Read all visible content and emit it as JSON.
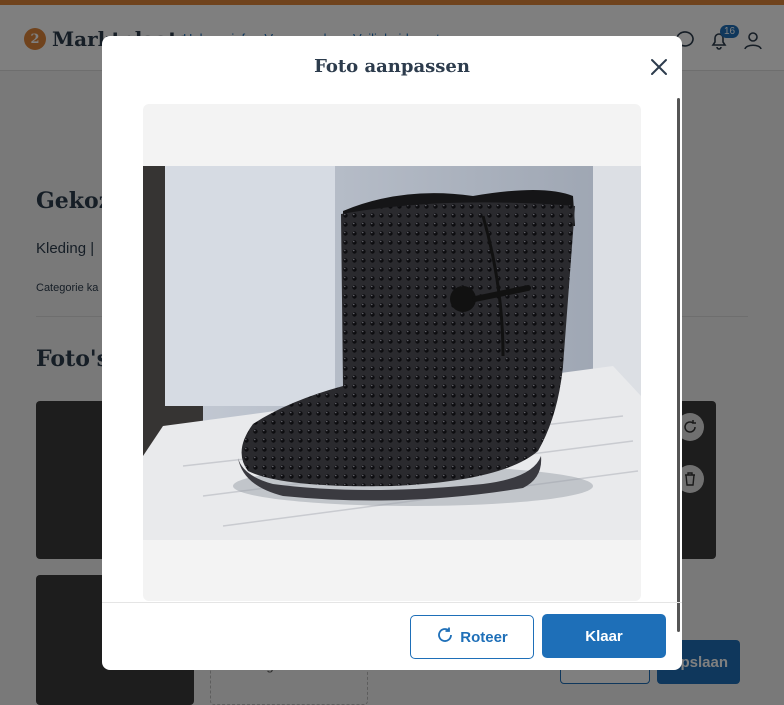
{
  "header": {
    "logo_text": "Marktplaats",
    "nav": [
      "Help en info",
      "Voorwaarden",
      "Veiligheidscentrum"
    ],
    "notification_count": "16"
  },
  "page": {
    "title": "Gekoze",
    "subtitle": "Kleding |",
    "category": "Categorie ka",
    "photos_heading": "Foto's",
    "add_photo": "Voeg foto's toe",
    "save_button": "Opslaan"
  },
  "modal": {
    "title": "Foto aanpassen",
    "rotate_button": "Roteer",
    "done_button": "Klaar"
  },
  "colors": {
    "brand_orange": "#e1863a",
    "primary_blue": "#1e6fb8",
    "text_dark": "#2d3c4d"
  },
  "icons": {
    "close": "close-icon",
    "rotate": "rotate-icon",
    "chat": "chat-icon",
    "bell": "bell-icon",
    "user": "user-icon",
    "trash": "trash-icon"
  }
}
